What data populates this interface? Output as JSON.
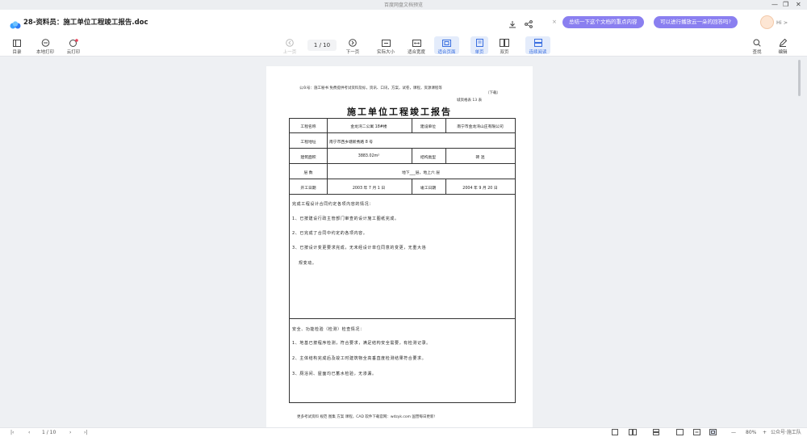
{
  "window": {
    "title": "百度网盘文档预览",
    "minimize": "—",
    "restore": "❐",
    "close": "✕"
  },
  "header": {
    "doc_title": "28-资料员：施工单位工程竣工报告.doc",
    "suggestions": [
      "总结一下这个文档的重点内容",
      "可以进行播放云一朵的回答吗?"
    ],
    "assistant_label": "Hi >"
  },
  "toolbar": {
    "left": [
      {
        "label": "目录",
        "icon": "toc-icon"
      },
      {
        "label": "本地打印",
        "icon": "printer-icon"
      },
      {
        "label": "云打印",
        "icon": "cloud-print-icon"
      }
    ],
    "prev_label": "上一页",
    "page_display": "1 / 10",
    "next_label": "下一页",
    "view": [
      {
        "label": "实际大小",
        "icon": "actual-size-icon"
      },
      {
        "label": "适合宽度",
        "icon": "fit-width-icon"
      },
      {
        "label": "适合页面",
        "icon": "fit-page-icon"
      },
      {
        "label": "单页",
        "icon": "single-page-icon"
      },
      {
        "label": "双页",
        "icon": "double-page-icon"
      },
      {
        "label": "连续阅读",
        "icon": "continuous-icon"
      }
    ],
    "right": [
      {
        "label": "查找",
        "icon": "search-icon"
      },
      {
        "label": "编辑",
        "icon": "edit-icon"
      }
    ]
  },
  "document": {
    "header_note": "公众号：施工秘书  免费提供考试资料及标，资讯、口讯，方案，试卷，课程，资源课程等",
    "header_note2": "（下载）",
    "form_no": "城资格表 13 表",
    "title": "施工单位工程竣工报告",
    "rows": [
      {
        "label": "工程名称",
        "value": "金龙湾二公寓 18#楼",
        "label2": "建设单位",
        "value2": "南宁市金龙湾山庄有限公司"
      },
      {
        "label": "工程地址",
        "value": "南宁市西乡塘新秀路 8 号"
      },
      {
        "label": "建筑面积",
        "value": "3883.02m²",
        "label2": "结构类型",
        "value2": "砖  混"
      },
      {
        "label": "层    数",
        "value": "地下___层，地上六  层"
      },
      {
        "label": "开工日期",
        "value": "2003 年 7 月 1 日",
        "label2": "竣工日期",
        "value2": "2004 年 9 月 20 日"
      }
    ],
    "section1": [
      "完成工程设计合同约定各项内容的情况：",
      "1、已按建设行政主管部门审查的设计施工图纸完成。",
      "2、已完成了合同中约定的各项内容。",
      "3、已按设计变更要求完成，无未经设计单位同意的变更，无重大违",
      "规变动。"
    ],
    "section2": [
      "安全、功能检验（检测）检查情况：",
      "1、地基已按程序检测，符合要求，满足结构安全需要，有检测记录。",
      "2、主体结构完成后及竣工时建筑物全高垂直度检测结果符合要求。",
      "3、厕浴间、屋面均已蓄水检验，无渗漏。"
    ],
    "footer": "更多考试资料 规范 图集 方案 课程，CAD 软件下载官网：wdzyk.com 国营每日更新!"
  },
  "statusbar": {
    "page_display": "1 / 10",
    "zoom": "80%",
    "zoom_minus": "—",
    "zoom_plus": "+",
    "watermark": "公众号·施工队"
  }
}
